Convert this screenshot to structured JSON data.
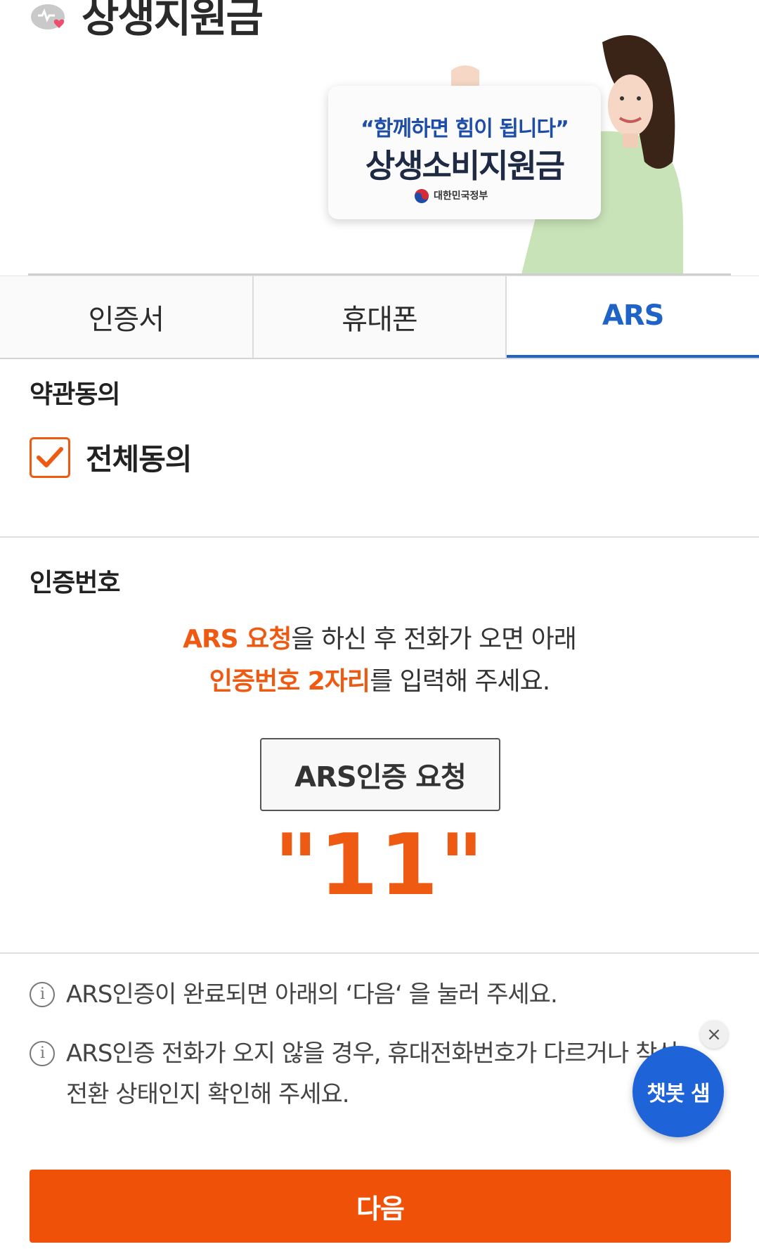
{
  "header": {
    "title": "상생지원금",
    "promo": {
      "quote": "“함께하면 힘이 됩니다”",
      "main": "상생소비지원금",
      "gov": "대한민국정부"
    }
  },
  "tabs": [
    {
      "label": "인증서",
      "active": false
    },
    {
      "label": "휴대폰",
      "active": false
    },
    {
      "label": "ARS",
      "active": true
    }
  ],
  "terms": {
    "section_label": "약관동의",
    "agree_all_label": "전체동의",
    "agree_all_checked": true
  },
  "verification": {
    "section_label": "인증번호",
    "instruction_line1_hl": "ARS 요청",
    "instruction_line1_rest": "을 하신 후 전화가 오면 아래",
    "instruction_line2_hl": "인증번호 2자리",
    "instruction_line2_rest": "를 입력해 주세요.",
    "ars_button_label": "ARS인증 요청",
    "code": "\"11\""
  },
  "notices": [
    "ARS인증이 완료되면 아래의 ‘다음‘ 을 눌러 주세요.",
    "ARS인증 전화가 오지 않을 경우, 휴대전화번호가 다르거나 착신 전환 상태인지 확인해 주세요."
  ],
  "chatbot": {
    "label": "챗봇 샘",
    "close": "×"
  },
  "next_button_label": "다음",
  "colors": {
    "accent": "#ef5a12",
    "tab_active": "#1f63c6",
    "chatbot": "#1f63d9"
  }
}
